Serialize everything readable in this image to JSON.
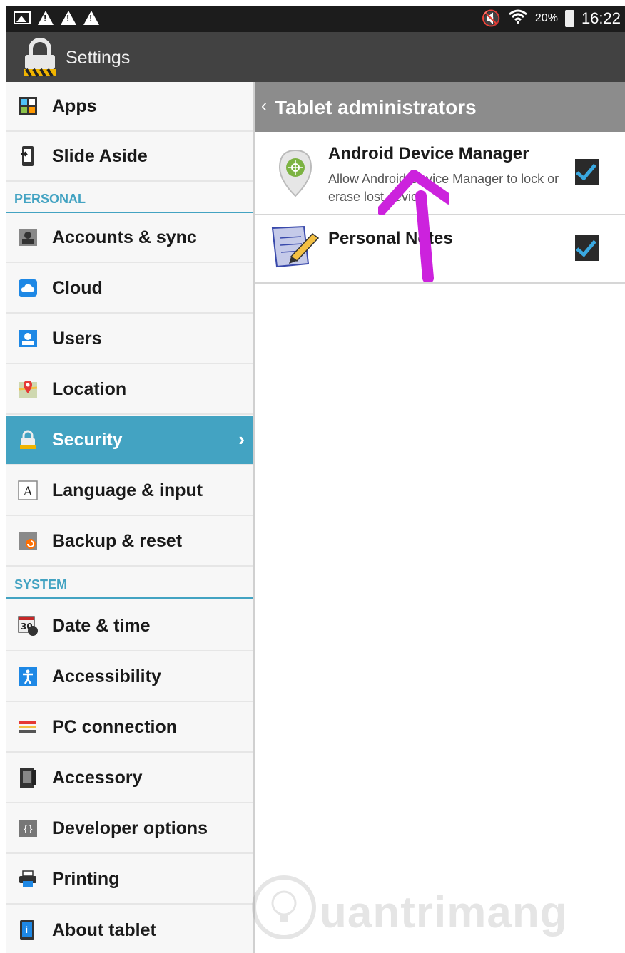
{
  "status_bar": {
    "battery": "20%",
    "time": "16:22"
  },
  "app": {
    "title": "Settings"
  },
  "left_menu": {
    "items_top": [
      {
        "label": "Apps"
      },
      {
        "label": "Slide Aside"
      }
    ],
    "section_personal": "PERSONAL",
    "items_personal": [
      {
        "label": "Accounts & sync"
      },
      {
        "label": "Cloud"
      },
      {
        "label": "Users"
      },
      {
        "label": "Location"
      },
      {
        "label": "Security"
      },
      {
        "label": "Language & input"
      },
      {
        "label": "Backup & reset"
      }
    ],
    "section_system": "SYSTEM",
    "items_system": [
      {
        "label": "Date & time"
      },
      {
        "label": "Accessibility"
      },
      {
        "label": "PC connection"
      },
      {
        "label": "Accessory"
      },
      {
        "label": "Developer options"
      },
      {
        "label": "Printing"
      },
      {
        "label": "About tablet"
      }
    ]
  },
  "detail": {
    "back_glyph": "‹",
    "title": "Tablet administrators",
    "admins": [
      {
        "name": "Android Device Manager",
        "description": "Allow Android Device Manager to lock or erase lost device",
        "checked": true
      },
      {
        "name": "Personal Notes",
        "checked": true
      }
    ]
  },
  "watermark": {
    "text": "uantrimang"
  },
  "colors": {
    "accent": "#43a3c2",
    "annotation_arrow": "#cc22dd"
  }
}
